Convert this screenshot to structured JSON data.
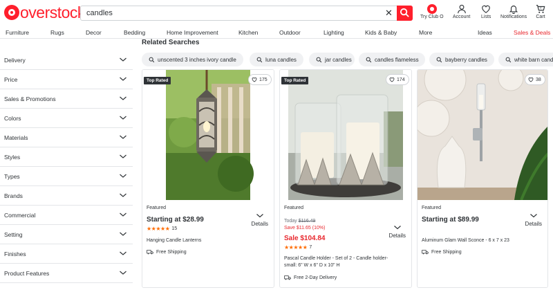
{
  "header": {
    "logo_text": "overstock",
    "search": {
      "value": "candles",
      "placeholder": ""
    },
    "icons": [
      {
        "name": "club",
        "label": "Try Club O",
        "badge": "club"
      },
      {
        "name": "account",
        "label": "Account"
      },
      {
        "name": "lists",
        "label": "Lists"
      },
      {
        "name": "notifications",
        "label": "Notifications"
      },
      {
        "name": "cart",
        "label": "Cart",
        "count": "0"
      }
    ],
    "brand_color": "#ff1f2c"
  },
  "nav": {
    "items": [
      "Furniture",
      "Rugs",
      "Decor",
      "Bedding",
      "Home Improvement",
      "Kitchen",
      "Outdoor",
      "Lighting",
      "Kids & Baby",
      "More"
    ],
    "right": [
      "Ideas",
      "Sales & Deals"
    ]
  },
  "sidebar": {
    "filters": [
      "Delivery",
      "Price",
      "Sales & Promotions",
      "Colors",
      "Materials",
      "Styles",
      "Types",
      "Brands",
      "Commercial",
      "Setting",
      "Finishes",
      "Product Features"
    ]
  },
  "related": {
    "title": "Related Searches",
    "chips": [
      "unscented 3 inches ivory candle",
      "luna candles",
      "jar candles",
      "candles flameless",
      "bayberry candles",
      "white barn candles"
    ]
  },
  "products": [
    {
      "top_rated": "Top Rated",
      "favorites": "175",
      "featured": "Featured",
      "price": "Starting at $28.99",
      "rating_count": "15",
      "rating": 5,
      "details": "Details",
      "name": "Hanging Candle Lanterns",
      "shipping": "Free Shipping"
    },
    {
      "top_rated": "Top Rated",
      "favorites": "174",
      "featured": "Featured",
      "today_label": "Today",
      "old_price": "$116.49",
      "save": "Save $11.65 (10%)",
      "price": "Sale $104.84",
      "rating_count": "7",
      "rating": 5,
      "details": "Details",
      "name": "Pascal Candle Holder - Set of 2 - Candle holder-small: 6\" W x 6\" D x 10\" H",
      "shipping": "Free 2-Day Delivery"
    },
    {
      "favorites": "38",
      "featured": "Featured",
      "price": "Starting at $89.99",
      "details": "Details",
      "name": "Aluminum Glam Wall Sconce - 6 x 7 x 23",
      "shipping": "Free Shipping"
    }
  ],
  "colors": {
    "accent": "#ff1f2c",
    "sale": "#e8272d",
    "star": "#ff6b00",
    "text": "#2f3337"
  }
}
